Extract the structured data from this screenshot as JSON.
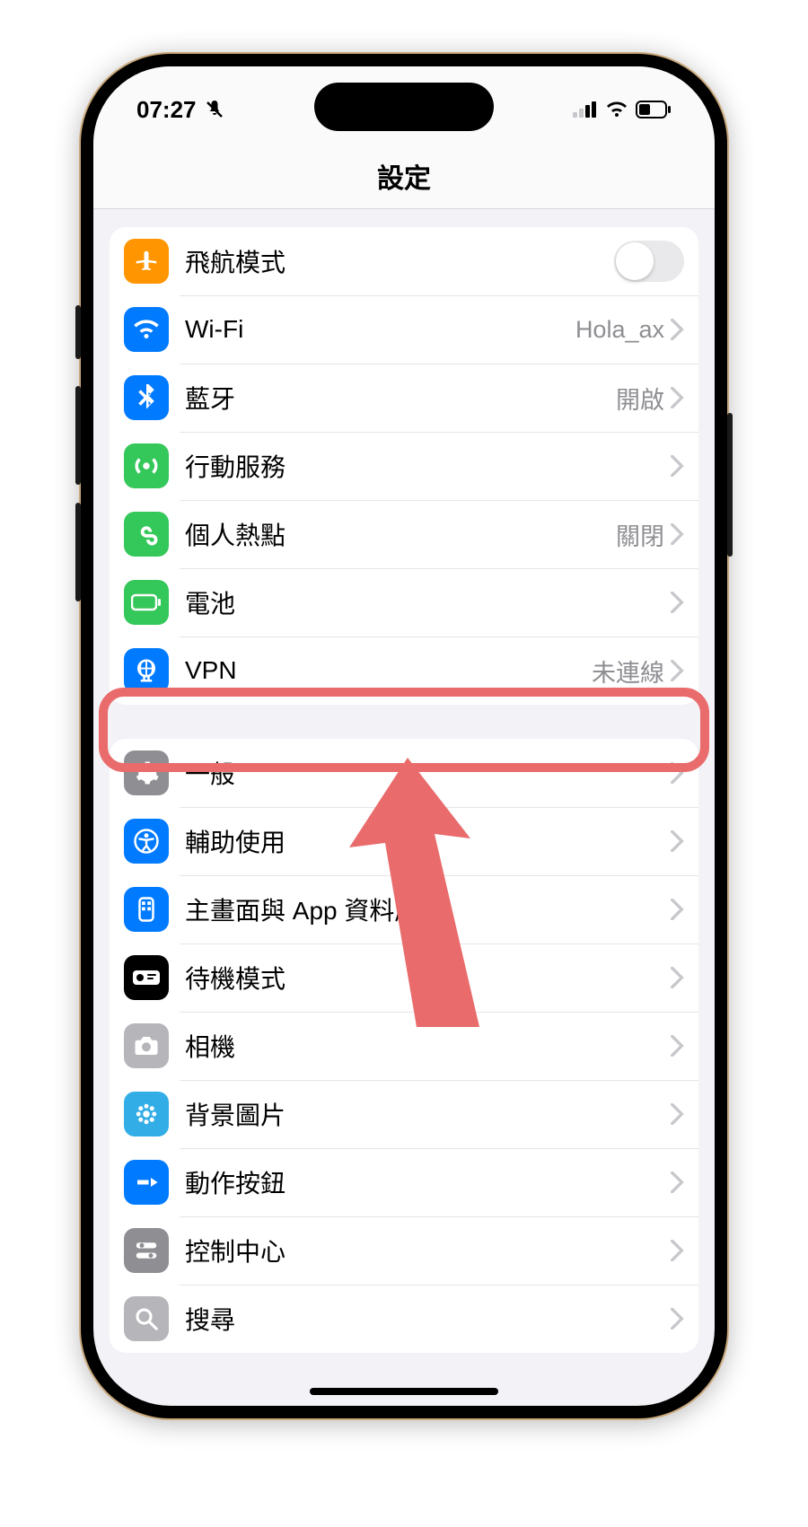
{
  "status": {
    "time": "07:27"
  },
  "header": {
    "title": "設定"
  },
  "group1": {
    "airplane": {
      "label": "飛航模式"
    },
    "wifi": {
      "label": "Wi-Fi",
      "value": "Hola_ax"
    },
    "bluetooth": {
      "label": "藍牙",
      "value": "開啟"
    },
    "cellular": {
      "label": "行動服務"
    },
    "hotspot": {
      "label": "個人熱點",
      "value": "關閉"
    },
    "battery": {
      "label": "電池"
    },
    "vpn": {
      "label": "VPN",
      "value": "未連線"
    }
  },
  "group2": {
    "general": {
      "label": "一般"
    },
    "accessibility": {
      "label": "輔助使用"
    },
    "homescreen": {
      "label": "主畫面與 App 資料庫"
    },
    "standby": {
      "label": "待機模式"
    },
    "camera": {
      "label": "相機"
    },
    "wallpaper": {
      "label": "背景圖片"
    },
    "action": {
      "label": "動作按鈕"
    },
    "control": {
      "label": "控制中心"
    },
    "search": {
      "label": "搜尋"
    }
  }
}
